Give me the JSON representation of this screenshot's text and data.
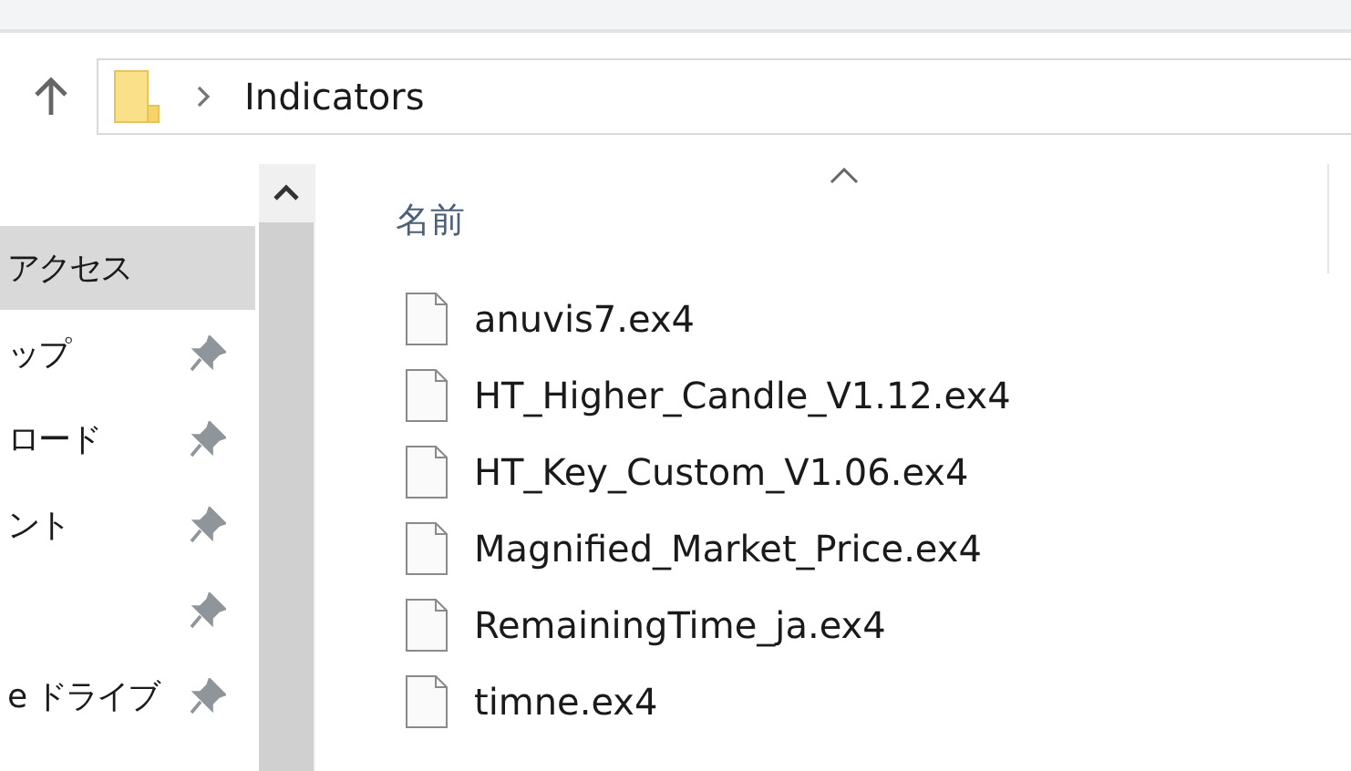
{
  "address_bar": {
    "path": "Indicators"
  },
  "nav_pane": {
    "items": [
      {
        "label": "アクセス",
        "selected": true,
        "pinned": false
      },
      {
        "label": "ップ",
        "selected": false,
        "pinned": true
      },
      {
        "label": "ロード",
        "selected": false,
        "pinned": true
      },
      {
        "label": "ント",
        "selected": false,
        "pinned": true
      },
      {
        "selected": false,
        "pinned": true
      },
      {
        "label": "e ドライブ",
        "selected": false,
        "pinned": true
      }
    ]
  },
  "file_list": {
    "columns": [
      {
        "label": "名前",
        "sorted": true
      }
    ],
    "files": [
      {
        "name": "anuvis7.ex4"
      },
      {
        "name": "HT_Higher_Candle_V1.12.ex4"
      },
      {
        "name": "HT_Key_Custom_V1.06.ex4"
      },
      {
        "name": "Magnified_Market_Price.ex4"
      },
      {
        "name": "RemainingTime_ja.ex4"
      },
      {
        "name": "timne.ex4"
      }
    ]
  }
}
